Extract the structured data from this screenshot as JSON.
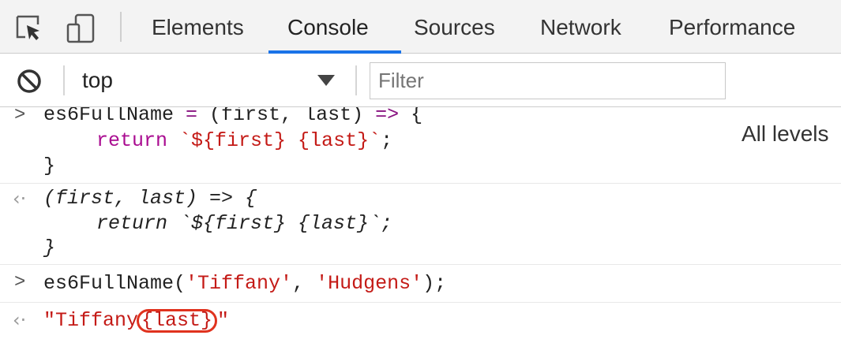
{
  "tabs": [
    {
      "label": "Elements"
    },
    {
      "label": "Console"
    },
    {
      "label": "Sources"
    },
    {
      "label": "Network"
    },
    {
      "label": "Performance"
    }
  ],
  "active_tab": "Console",
  "toolbar": {
    "context": "top",
    "filter_placeholder": "Filter",
    "levels": "All levels"
  },
  "console": {
    "entry1_input": {
      "l1_name": "es6FullName",
      "l1_eq": " = ",
      "l1_params": "(first, last)",
      "l1_arrow": " => ",
      "l1_brace": "{",
      "l2_return": "return",
      "l2_tpl": "`${first} {last}`",
      "l2_semi": ";",
      "l3": "}"
    },
    "entry1_output": {
      "l1": "(first, last) => {",
      "l2": "return `${first} {last}`;",
      "l3": "}"
    },
    "entry2_input": {
      "fn": "es6FullName(",
      "arg1": "'Tiffany'",
      "comma": ", ",
      "arg2": "'Hudgens'",
      "end": ");"
    },
    "entry2_output": {
      "open": "\"Tiffany",
      "highlighted": "{last}",
      "close": "\""
    }
  },
  "colors": {
    "keyword": "#aa0d91",
    "string": "#c41a16",
    "active_tab_underline": "#1a73e8",
    "highlight_ring": "#e0321e"
  },
  "icons": [
    "inspect-element-icon",
    "device-toolbar-icon",
    "clear-console-icon",
    "dropdown-arrow-icon",
    "input-prompt-icon",
    "result-arrow-icon"
  ]
}
